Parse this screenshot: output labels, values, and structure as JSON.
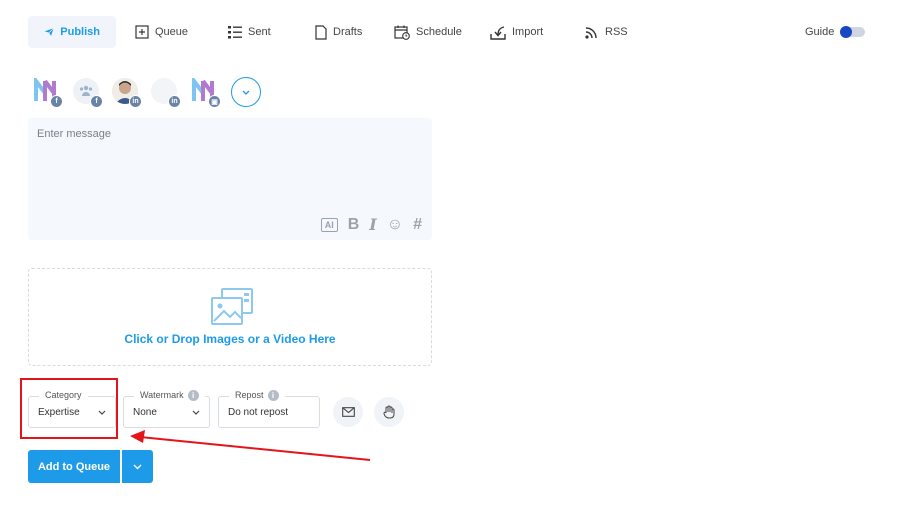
{
  "nav": {
    "items": [
      {
        "label": "Publish",
        "icon": "paper-plane-icon",
        "active": true
      },
      {
        "label": "Queue",
        "icon": "queue-add-icon"
      },
      {
        "label": "Sent",
        "icon": "list-icon"
      },
      {
        "label": "Drafts",
        "icon": "document-icon"
      },
      {
        "label": "Schedule",
        "icon": "calendar-clock-icon"
      },
      {
        "label": "Import",
        "icon": "import-icon"
      },
      {
        "label": "RSS",
        "icon": "rss-icon"
      }
    ],
    "guide_label": "Guide",
    "guide_on": true
  },
  "accounts": [
    {
      "type": "page-logo",
      "network": "f"
    },
    {
      "type": "group",
      "network": "f"
    },
    {
      "type": "person",
      "network": "in"
    },
    {
      "type": "blank",
      "network": "in"
    },
    {
      "type": "page-logo",
      "network": "▣"
    }
  ],
  "composer": {
    "placeholder": "Enter message",
    "tools": [
      "AI",
      "B",
      "I",
      "☺",
      "#"
    ]
  },
  "media": {
    "drop_label": "Click or Drop Images or a Video Here"
  },
  "options": {
    "category": {
      "label": "Category",
      "value": "Expertise"
    },
    "watermark": {
      "label": "Watermark",
      "value": "None"
    },
    "repost": {
      "label": "Repost",
      "value": "Do not repost"
    }
  },
  "actions": {
    "add_to_queue": "Add to Queue"
  },
  "colors": {
    "accent": "#1e9be8",
    "highlight": "#e4141b"
  }
}
